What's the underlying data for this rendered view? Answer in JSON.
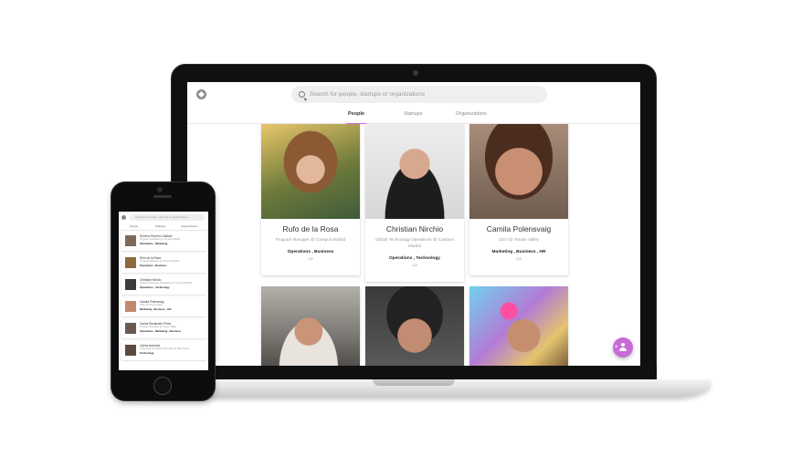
{
  "app": {
    "search_placeholder": "Search for people, startups or organizations",
    "tabs": [
      {
        "label": "People",
        "active": true
      },
      {
        "label": "Startups",
        "active": false
      },
      {
        "label": "Organizations",
        "active": false
      }
    ],
    "accent_color": "#c86ad8",
    "people": [
      {
        "name": "Rufo de la Rosa",
        "role": "Program Manager @ Campus Madrid",
        "tags": "Operations , Business",
        "level": "L3"
      },
      {
        "name": "Christian Nirchio",
        "role": "Global Technology Operations @ Campus Madrid",
        "tags": "Operations , Technology",
        "level": "L3"
      },
      {
        "name": "Camila Polensvaig",
        "role": "CEO @ Tetuan Valley",
        "tags": "Marketing , Business , HR",
        "level": "L3"
      }
    ]
  },
  "mobile": {
    "search_placeholder": "Search for people, startups or organizations",
    "tabs": [
      "People",
      "Startups",
      "Organizations"
    ],
    "list": [
      {
        "name": "Roberto Romero Galindo",
        "role": "Program Facilitator @ Campus Madrid",
        "tags": "Operations , Marketing"
      },
      {
        "name": "Rufo de la Rosa",
        "role": "Program Manager @ Campus Madrid",
        "tags": "Operations , Business"
      },
      {
        "name": "Christian Nirchio",
        "role": "Global Technology Operations @ Campus Madrid",
        "tags": "Operations , Technology"
      },
      {
        "name": "Camila Polensvaig",
        "role": "CEO @ Tetuan Valley",
        "tags": "Marketing , Business , HR"
      },
      {
        "name": "Carlos Recalcaño Pérez",
        "role": "Program Manager @ Tetuan Valley",
        "tags": "Operations , Marketing , Business"
      },
      {
        "name": "Carlos Azevedo",
        "role": "Cofounder, Developer Advocate @ Daily Fakes",
        "tags": "Technology"
      }
    ]
  }
}
